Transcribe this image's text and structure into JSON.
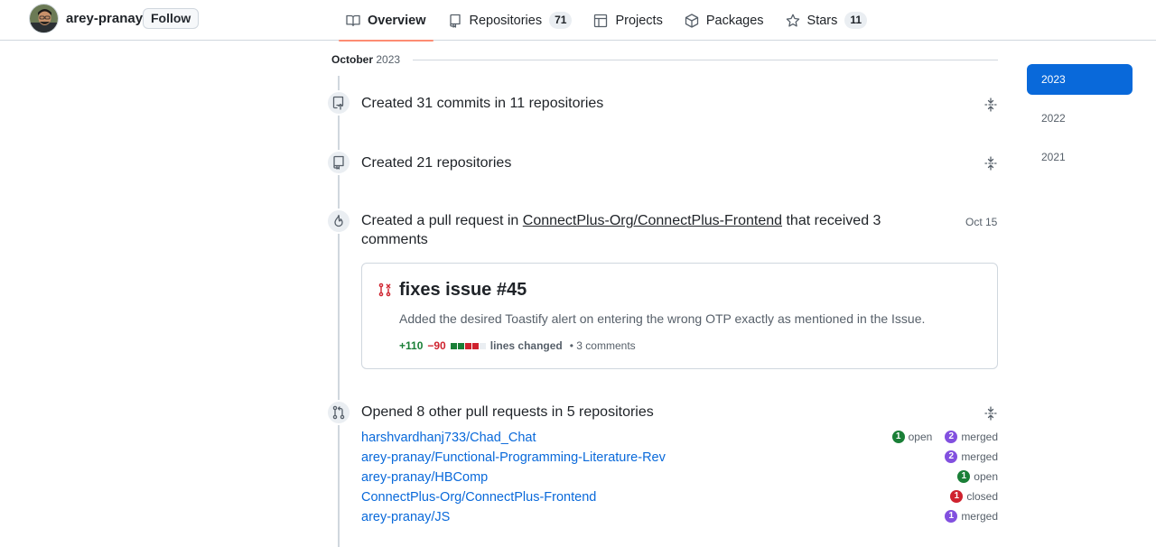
{
  "profile": {
    "username": "arey-pranay",
    "follow_label": "Follow"
  },
  "nav": {
    "tabs": [
      {
        "label": "Overview",
        "icon": "book-icon",
        "active": true
      },
      {
        "label": "Repositories",
        "icon": "repo-icon",
        "count": "71"
      },
      {
        "label": "Projects",
        "icon": "table-icon"
      },
      {
        "label": "Packages",
        "icon": "package-icon"
      },
      {
        "label": "Stars",
        "icon": "star-icon",
        "count": "11"
      }
    ]
  },
  "activity": {
    "month": "October",
    "year": "2023",
    "commits": {
      "text": "Created 31 commits in 11 repositories",
      "icon": "repo-push-icon"
    },
    "repos_created": {
      "text": "Created 21 repositories",
      "icon": "repo-icon"
    },
    "pull_request": {
      "prefix": "Created a pull request in ",
      "repo": "ConnectPlus-Org/ConnectPlus-Frontend",
      "suffix": " that received 3 comments",
      "date": "Oct 15",
      "title": "fixes issue #45",
      "description": "Added the desired Toastify alert on entering the wrong OTP exactly as mentioned in the Issue.",
      "additions": "+110",
      "deletions": "−90",
      "lines_changed": "lines changed",
      "comments": "• 3 comments"
    },
    "other_prs": {
      "text": "Opened 8 other pull requests in 5 repositories",
      "repos": [
        {
          "name": "harshvardhanj733/Chad_Chat",
          "states": [
            {
              "count": "1",
              "label": "open",
              "color": "#1a7f37"
            },
            {
              "count": "2",
              "label": "merged",
              "color": "#8250df"
            }
          ]
        },
        {
          "name": "arey-pranay/Functional-Programming-Literature-Rev",
          "states": [
            {
              "count": "2",
              "label": "merged",
              "color": "#8250df"
            }
          ]
        },
        {
          "name": "arey-pranay/HBComp",
          "states": [
            {
              "count": "1",
              "label": "open",
              "color": "#1a7f37"
            }
          ]
        },
        {
          "name": "ConnectPlus-Org/ConnectPlus-Frontend",
          "states": [
            {
              "count": "1",
              "label": "closed",
              "color": "#cf222e"
            }
          ]
        },
        {
          "name": "arey-pranay/JS",
          "states": [
            {
              "count": "1",
              "label": "merged",
              "color": "#8250df"
            }
          ]
        }
      ]
    }
  },
  "years": [
    "2023",
    "2022",
    "2021"
  ],
  "colors": {
    "accent": "#0969da",
    "tab_underline": "#fd8c73",
    "additions": "#1a7f37",
    "deletions": "#cf222e"
  }
}
